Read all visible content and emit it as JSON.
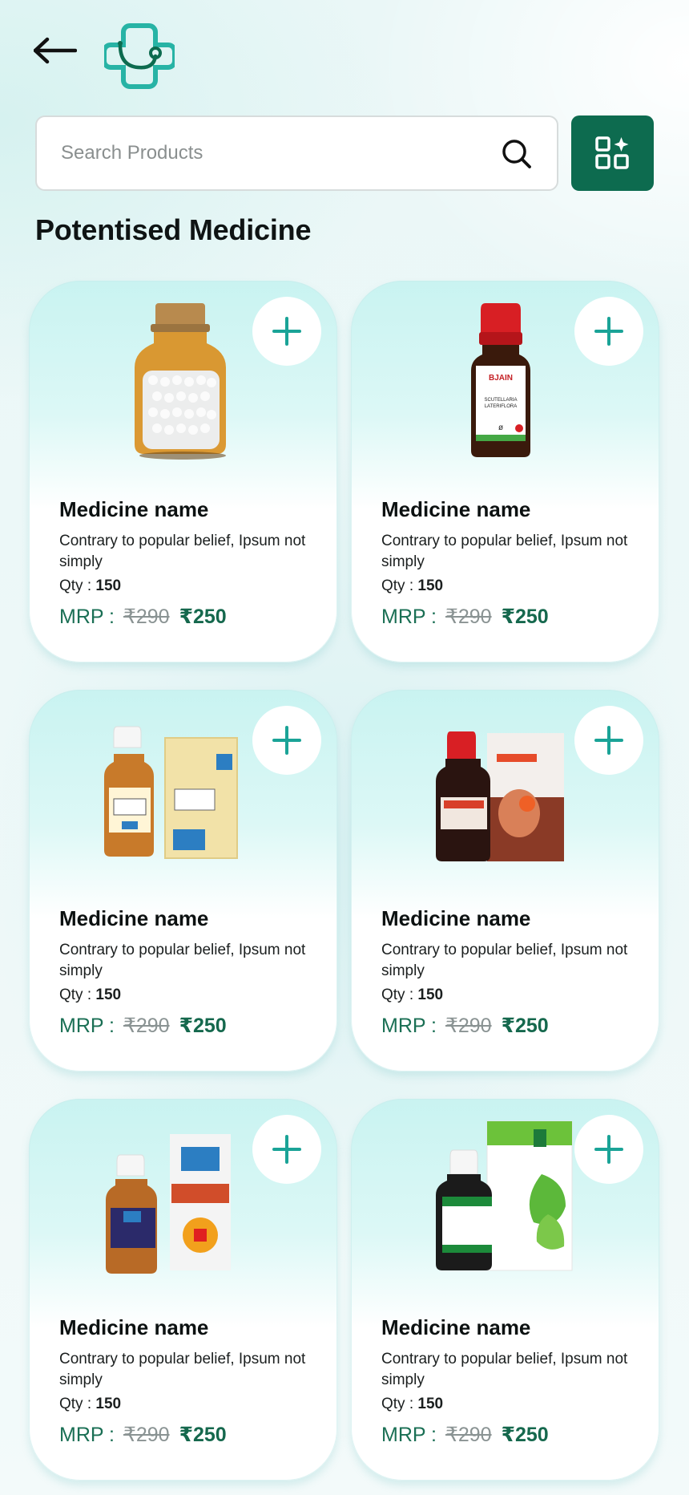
{
  "header": {
    "back_icon": "arrow-left-icon",
    "logo_icon": "medical-cross-stethoscope-logo"
  },
  "search": {
    "placeholder": "Search Products",
    "icon": "search-icon"
  },
  "grid_button": {
    "icon": "grid-sparkle-icon"
  },
  "page": {
    "title": "Potentised Medicine"
  },
  "colors": {
    "brand": "#0d6b4f",
    "accent": "#1aa397",
    "price": "#15684d",
    "card_top": "#c9f3f1"
  },
  "products": [
    {
      "name": "Medicine name",
      "desc": "Contrary to popular belief, Ipsum not simply",
      "qty_label": "Qty :",
      "qty": "150",
      "mrp_label": "MRP :",
      "old_price": "₹290",
      "new_price": "₹250",
      "image": "glass-jar-pills"
    },
    {
      "name": "Medicine name",
      "desc": "Contrary to popular belief, Ipsum not simply",
      "qty_label": "Qty :",
      "qty": "150",
      "mrp_label": "MRP :",
      "old_price": "₹290",
      "new_price": "₹250",
      "image": "red-cap-bottle"
    },
    {
      "name": "Medicine name",
      "desc": "Contrary to popular belief, Ipsum not simply",
      "qty_label": "Qty :",
      "qty": "150",
      "mrp_label": "MRP :",
      "old_price": "₹290",
      "new_price": "₹250",
      "image": "bottle-with-box"
    },
    {
      "name": "Medicine name",
      "desc": "Contrary to popular belief, Ipsum not simply",
      "qty_label": "Qty :",
      "qty": "150",
      "mrp_label": "MRP :",
      "old_price": "₹290",
      "new_price": "₹250",
      "image": "red-bottle-with-box"
    },
    {
      "name": "Medicine name",
      "desc": "Contrary to popular belief, Ipsum not simply",
      "qty_label": "Qty :",
      "qty": "150",
      "mrp_label": "MRP :",
      "old_price": "₹290",
      "new_price": "₹250",
      "image": "bottle-with-box"
    },
    {
      "name": "Medicine name",
      "desc": "Contrary to popular belief, Ipsum not simply",
      "qty_label": "Qty :",
      "qty": "150",
      "mrp_label": "MRP :",
      "old_price": "₹290",
      "new_price": "₹250",
      "image": "green-box-bottle"
    }
  ]
}
